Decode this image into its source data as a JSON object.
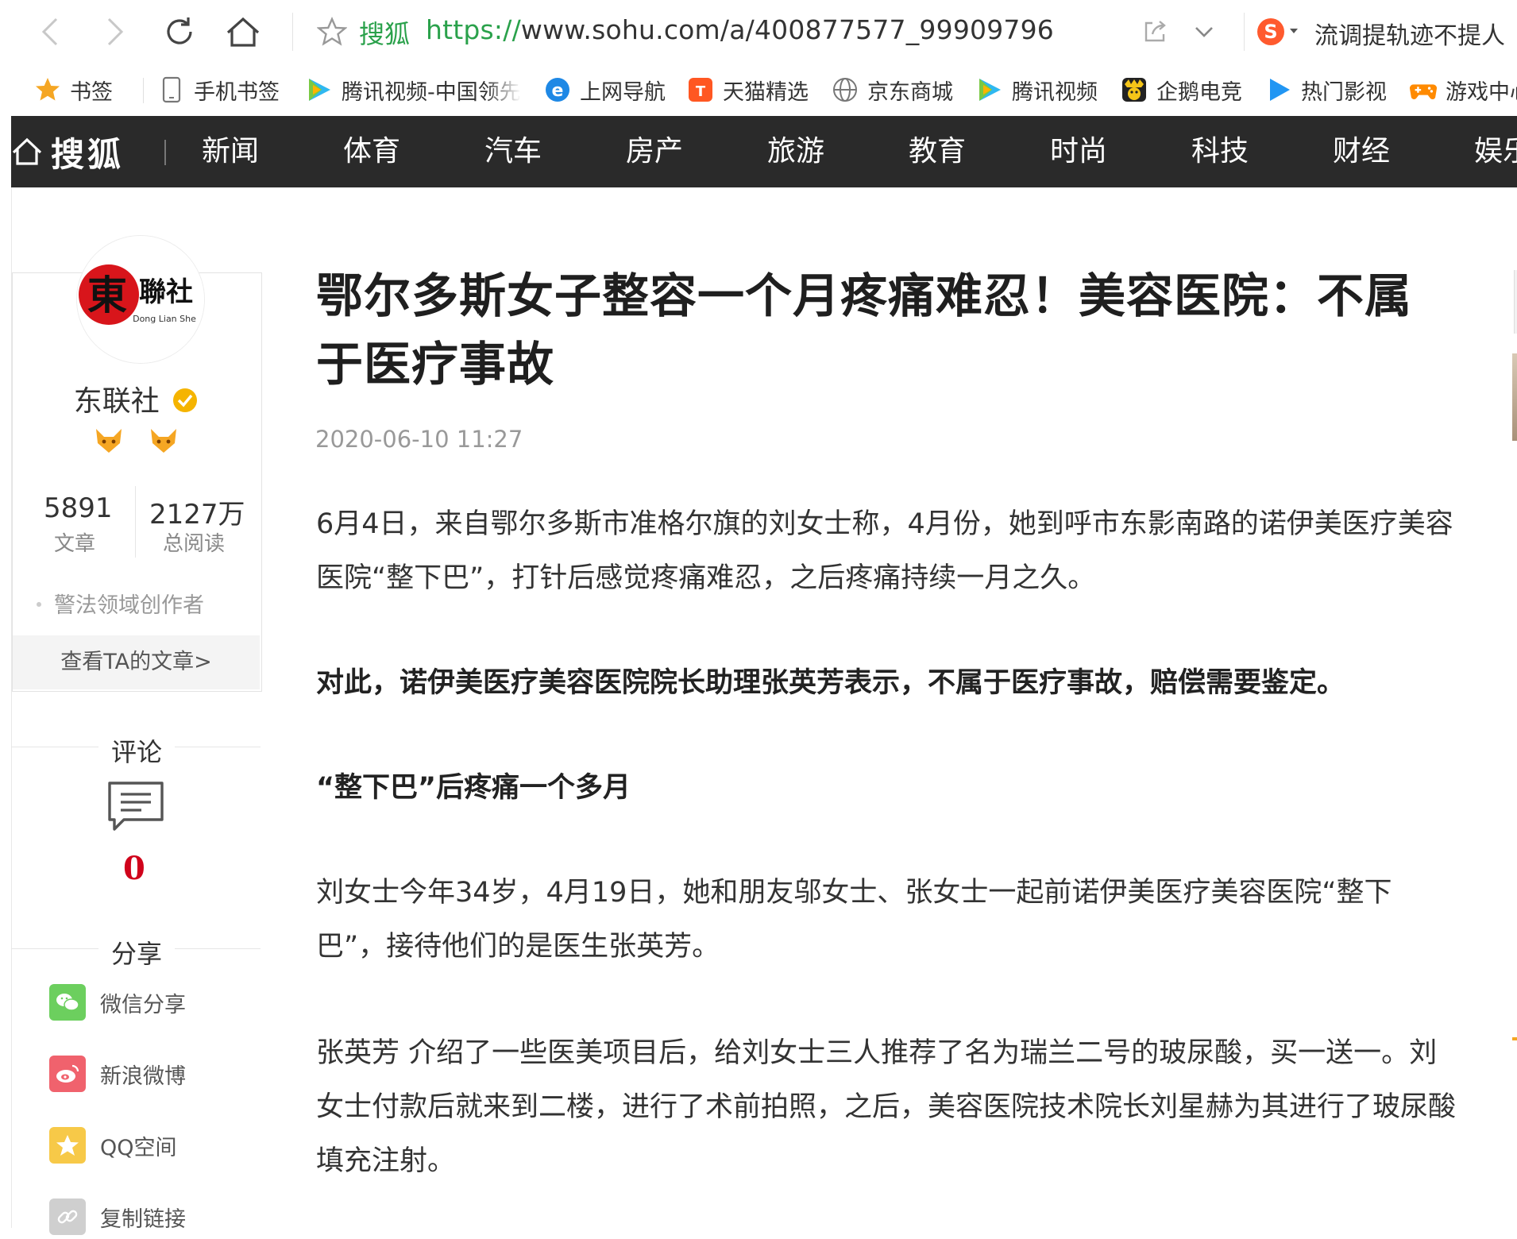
{
  "browser": {
    "address_site_label": "搜狐",
    "url_scheme": "https://",
    "url_rest": "www.sohu.com/a/400877577_99909796",
    "search_suggestion": "流调提轨迹不提人",
    "icons": [
      "back-arrow-icon",
      "forward-arrow-icon",
      "reload-icon",
      "home-icon",
      "star-icon",
      "share-out-icon",
      "chevron-down-icon",
      "sogou-search-icon"
    ]
  },
  "bookmarks": {
    "items": [
      {
        "label": "书签",
        "icon": "star-icon"
      },
      {
        "label": "手机书签",
        "icon": "phone-icon"
      },
      {
        "label": "腾讯视频-中国领先",
        "icon": "tencent-video-icon"
      },
      {
        "label": "上网导航",
        "icon": "ie-icon"
      },
      {
        "label": "天猫精选",
        "icon": "tmall-icon"
      },
      {
        "label": "京东商城",
        "icon": "globe-icon"
      },
      {
        "label": "腾讯视频",
        "icon": "tencent-video-icon"
      },
      {
        "label": "企鹅电竞",
        "icon": "penguin-esports-icon"
      },
      {
        "label": "热门影视",
        "icon": "play-icon"
      },
      {
        "label": "游戏中心",
        "icon": "gamepad-icon"
      }
    ]
  },
  "sohu_nav": {
    "logo_text": "搜狐",
    "items": [
      "新闻",
      "体育",
      "汽车",
      "房产",
      "旅游",
      "教育",
      "时尚",
      "科技",
      "财经",
      "娱乐"
    ]
  },
  "author": {
    "name": "东联社",
    "logo_text_cn": "東聯社",
    "logo_text_en": "Dong Lian She",
    "articles_count": "5891",
    "articles_label": "文章",
    "reads_count": "2127万",
    "reads_label": "总阅读",
    "domain_tag": "警法领域创作者",
    "view_articles_link": "查看TA的文章>"
  },
  "sidebar": {
    "comment_title": "评论",
    "comment_count": "0",
    "share_title": "分享",
    "share_items": [
      {
        "label": "微信分享",
        "icon": "wechat-icon",
        "color": "#6ccf5e"
      },
      {
        "label": "新浪微博",
        "icon": "weibo-icon",
        "color": "#f0626d"
      },
      {
        "label": "QQ空间",
        "icon": "qzone-icon",
        "color": "#f7c948"
      },
      {
        "label": "复制链接",
        "icon": "link-icon",
        "color": "#cfcfcf"
      }
    ]
  },
  "article": {
    "title": "鄂尔多斯女子整容一个月疼痛难忍！美容医院：不属于医疗事故",
    "time": "2020-06-10 11:27",
    "paragraphs": [
      {
        "text": "6月4日，来自鄂尔多斯市准格尔旗的刘女士称，4月份，她到呼市东影南路的诺伊美医疗美容医院“整下巴”，打针后感觉疼痛难忍，之后疼痛持续一月之久。",
        "bold": false
      },
      {
        "text": "对此，诺伊美医疗美容医院院长助理张英芳表示，不属于医疗事故，赔偿需要鉴定。",
        "bold": true
      },
      {
        "text": "“整下巴”后疼痛一个多月",
        "bold": true
      },
      {
        "text": "刘女士今年34岁，4月19日，她和朋友邬女士、张女士一起前诺伊美医疗美容医院“整下巴”，接待他们的是医生张英芳。",
        "bold": false
      },
      {
        "text": "张英芳 介绍了一些医美项目后，给刘女士三人推荐了名为瑞兰二号的玻尿酸，买一送一。刘女士付款后就来到二楼，进行了术前拍照，之后，美容医院技术院长刘星赫为其进行了玻尿酸填充注射。",
        "bold": false
      }
    ]
  }
}
